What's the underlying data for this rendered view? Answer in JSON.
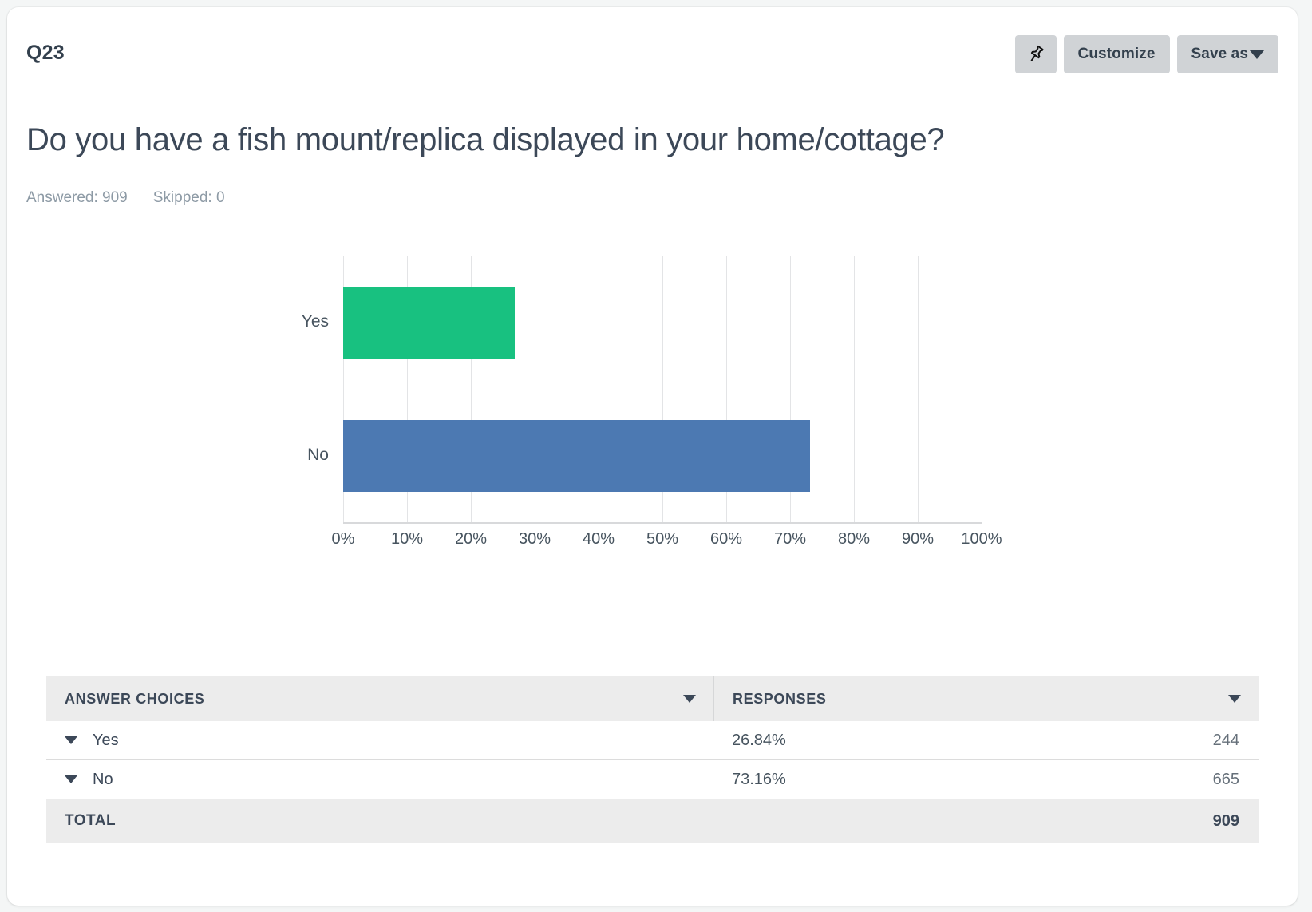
{
  "header": {
    "question_number": "Q23",
    "pin_icon": "pushpin-icon",
    "customize_label": "Customize",
    "save_as_label": "Save as"
  },
  "question": {
    "title": "Do you have a fish mount/replica displayed in your home/cottage?",
    "answered_label": "Answered: 909",
    "skipped_label": "Skipped: 0"
  },
  "table": {
    "columns": [
      "ANSWER CHOICES",
      "RESPONSES"
    ],
    "rows": [
      {
        "choice": "Yes",
        "percent": "26.84%",
        "count": "244"
      },
      {
        "choice": "No",
        "percent": "73.16%",
        "count": "665"
      }
    ],
    "total_label": "TOTAL",
    "total_count": "909"
  },
  "chart_data": {
    "type": "bar",
    "orientation": "horizontal",
    "title": "",
    "categories": [
      "Yes",
      "No"
    ],
    "values": [
      26.84,
      73.16
    ],
    "colors": [
      "#18c180",
      "#4c79b2"
    ],
    "xlabel": "",
    "ylabel": "",
    "xlim": [
      0,
      100
    ],
    "xticks": [
      0,
      10,
      20,
      30,
      40,
      50,
      60,
      70,
      80,
      90,
      100
    ],
    "xtick_labels": [
      "0%",
      "10%",
      "20%",
      "30%",
      "40%",
      "50%",
      "60%",
      "70%",
      "80%",
      "90%",
      "100%"
    ],
    "grid": "vertical",
    "legend": "none"
  }
}
